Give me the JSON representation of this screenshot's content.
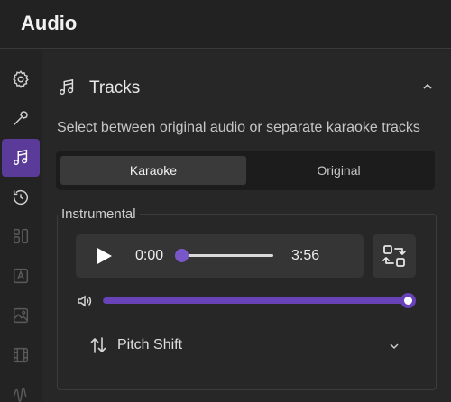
{
  "header": {
    "title": "Audio"
  },
  "sidebar": {
    "items": [
      {
        "icon": "gear-icon",
        "active": false
      },
      {
        "icon": "wand-icon",
        "active": false
      },
      {
        "icon": "music-note-icon",
        "active": true
      },
      {
        "icon": "history-icon",
        "active": false
      },
      {
        "icon": "layout-icon",
        "active": false
      },
      {
        "icon": "text-icon",
        "active": false
      },
      {
        "icon": "image-icon",
        "active": false
      },
      {
        "icon": "film-icon",
        "active": false
      },
      {
        "icon": "waveform-icon",
        "active": false
      }
    ]
  },
  "tracks": {
    "title": "Tracks",
    "description": "Select between original audio or separate karaoke tracks",
    "tabs": [
      {
        "label": "Karaoke",
        "selected": true
      },
      {
        "label": "Original",
        "selected": false
      }
    ],
    "group_label": "Instrumental",
    "player": {
      "current_time": "0:00",
      "total_time": "3:56",
      "progress": 0.0
    },
    "volume": {
      "level": 1.0
    },
    "pitch": {
      "label": "Pitch Shift"
    }
  },
  "colors": {
    "accent": "#6843b7",
    "active_sidebar": "#5b3b99",
    "background": "#232323",
    "panel": "#272727"
  }
}
